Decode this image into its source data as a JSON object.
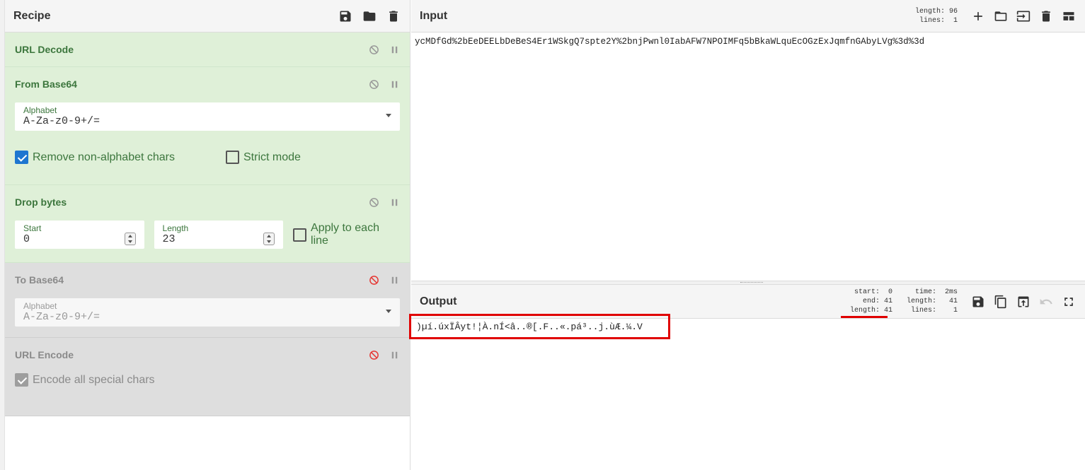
{
  "recipe": {
    "title": "Recipe",
    "operations": [
      {
        "name": "URL Decode",
        "enabled": true
      },
      {
        "name": "From Base64",
        "enabled": true,
        "alphabet_label": "Alphabet",
        "alphabet_value": "A-Za-z0-9+/=",
        "remove_nonalpha_label": "Remove non-alphabet chars",
        "remove_nonalpha_checked": true,
        "strict_label": "Strict mode",
        "strict_checked": false
      },
      {
        "name": "Drop bytes",
        "enabled": true,
        "start_label": "Start",
        "start_value": "0",
        "length_label": "Length",
        "length_value": "23",
        "each_line_label": "Apply to each line",
        "each_line_checked": false
      },
      {
        "name": "To Base64",
        "enabled": false,
        "alphabet_label": "Alphabet",
        "alphabet_value": "A-Za-z0-9+/="
      },
      {
        "name": "URL Encode",
        "enabled": false,
        "encode_all_label": "Encode all special chars",
        "encode_all_checked": true
      }
    ]
  },
  "input": {
    "title": "Input",
    "meta": "length: 96\n lines:  1",
    "text": "ycMDfGd%2bEeDEELbDeBeS4Er1WSkgQ7spte2Y%2bnjPwnl0IabAFW7NPOIMFq5bBkaWLquEcOGzExJqmfnGAbyLVg%3d%3d"
  },
  "output": {
    "title": "Output",
    "meta_left": "start:  0\n  end: 41\nlength: 41",
    "meta_right": "  time:  2ms\nlength:   41\n lines:    1",
    "text": ")µí.úxÏÂyt!¦À.nÍ<â..®[.F..«.pá³..j.ùÆ.¼.V"
  },
  "colors": {
    "enabled_bg": "#dff0d8",
    "disabled_bg": "#dedede",
    "op_green": "#3c763d",
    "highlight_red": "#e00000",
    "checkbox_blue": "#1e76d0"
  }
}
